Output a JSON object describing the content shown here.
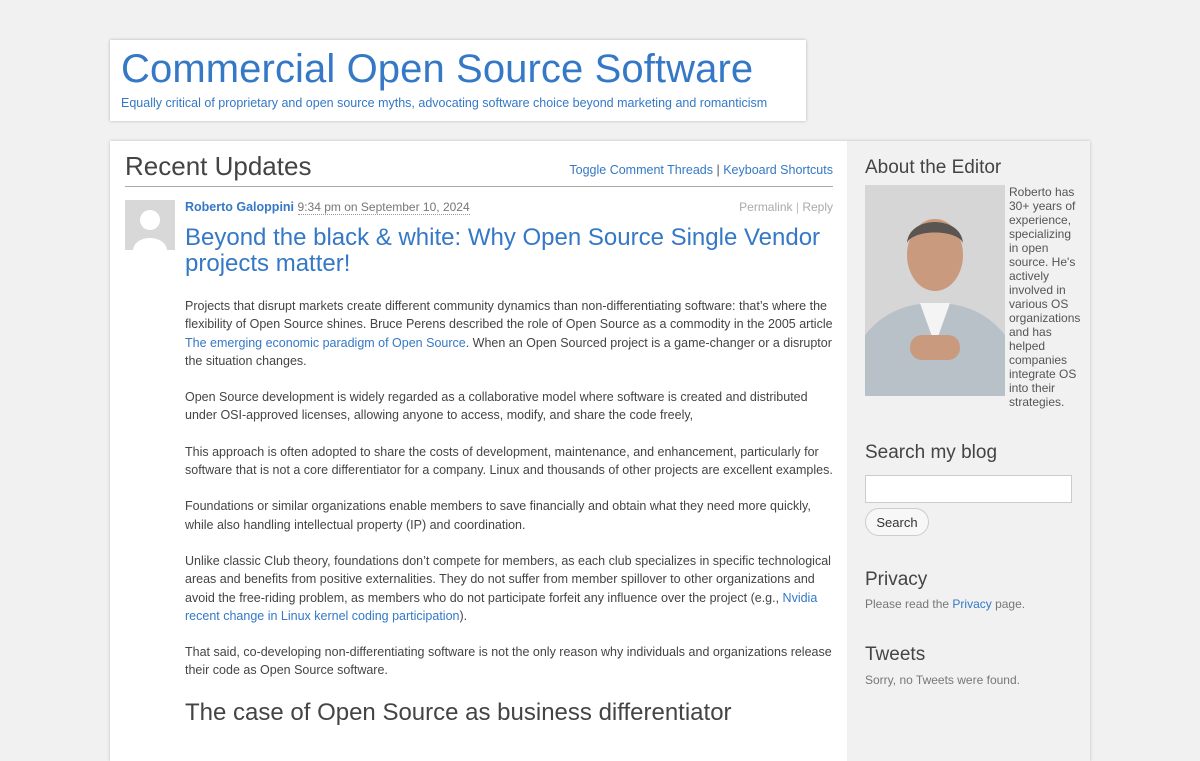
{
  "header": {
    "title": "Commercial Open Source Software",
    "tagline": "Equally critical of proprietary and open source myths, advocating software choice beyond marketing and romanticism"
  },
  "updates": {
    "title": "Recent Updates",
    "toggle_link": "Toggle Comment Threads",
    "separator": "|",
    "shortcuts_link": "Keyboard Shortcuts"
  },
  "post": {
    "author": "Roberto Galoppini",
    "date": "9:34 pm on September 10, 2024",
    "permalink": "Permalink",
    "action_separator": "|",
    "reply": "Reply",
    "title": "Beyond the black & white: Why Open Source Single Vendor projects matter!",
    "p1_a": "Projects that disrupt markets create different community dynamics than non-differentiating software: that’s where the flexibility of Open Source shines. Bruce Perens described the role of Open Source as a commodity in the 2005 article ",
    "p1_link": "The emerging economic paradigm of Open Source",
    "p1_b": ". When an Open Sourced project is a game-changer or a disruptor the situation changes.",
    "p2": "Open Source development is widely regarded as a collaborative model where software is created and distributed under OSI-approved licenses, allowing anyone to access, modify, and share the code freely,",
    "p3": "This approach is often adopted to share the costs of development, maintenance, and enhancement, particularly for software that is not a core differentiator for a company. Linux and thousands of other projects are excellent examples.",
    "p4": "Foundations or similar organizations enable members to save financially and obtain what they need more quickly, while also handling intellectual property (IP) and coordination.",
    "p5_a": "Unlike classic Club theory, foundations don’t compete for members, as each club specializes in specific technological areas and benefits from positive externalities. They do not suffer from member spillover to other organizations and avoid the free-riding problem, as members who do not participate forfeit any influence over the project (e.g., ",
    "p5_link": "Nvidia recent change in Linux kernel coding participation",
    "p5_b": ").",
    "p6": "That said, co-developing non-differentiating software is not the only reason why individuals and organizations release their code as Open Source software.",
    "subheading": "The case of Open Source as business differentiator"
  },
  "sidebar": {
    "about_title": "About the Editor",
    "about_text": "Roberto has 30+ years of experience, specializing in open source. He's actively involved in various OS organizations and has helped companies integrate OS into their strategies.",
    "search_title": "Search my blog",
    "search_button": "Search",
    "search_value": "",
    "privacy_title": "Privacy",
    "privacy_pre": "Please read the ",
    "privacy_link": "Privacy",
    "privacy_post": " page.",
    "tweets_title": "Tweets",
    "tweets_text": "Sorry, no Tweets were found."
  },
  "colors": {
    "accent": "#3478c6",
    "background": "#f1f1f1",
    "sidebar_bg": "#f1f1f1",
    "panel_bg": "#ffffff"
  }
}
